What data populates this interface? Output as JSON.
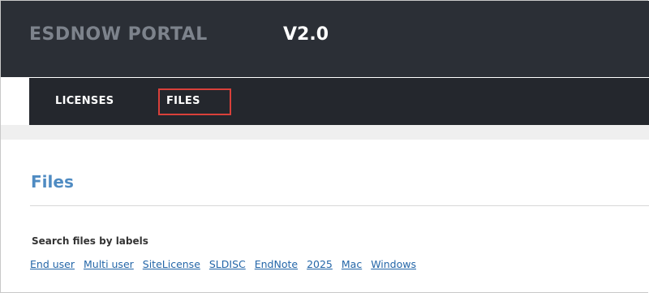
{
  "header": {
    "brand": "ESDNOW PORTAL",
    "version": "V2.0"
  },
  "nav": {
    "items": [
      {
        "label": "LICENSES"
      },
      {
        "label": "FILES"
      }
    ],
    "highlight_color": "#d9403a"
  },
  "main": {
    "title": "Files",
    "search_label": "Search files by labels",
    "labels": [
      "End user",
      "Multi user",
      "SiteLicense",
      "SLDISC",
      "EndNote",
      "2025",
      "Mac",
      "Windows"
    ]
  },
  "colors": {
    "header_bg": "#2b2f36",
    "nav_bg": "#24272d",
    "heading": "#4f8bc2",
    "link": "#2466a8"
  }
}
